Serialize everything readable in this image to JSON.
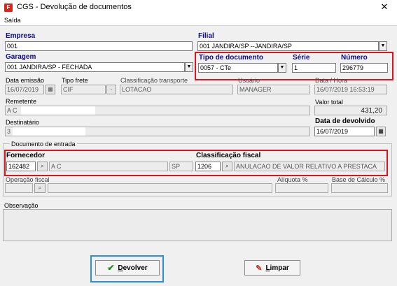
{
  "window": {
    "title": "CGS - Devolução de documentos",
    "close_glyph": "✕",
    "icon_letter": "F"
  },
  "menu": {
    "saida": "Saída"
  },
  "empresa": {
    "label": "Empresa",
    "value": "001"
  },
  "filial": {
    "label": "Filial",
    "value": "001 JANDIRA/SP --JANDIRA/SP"
  },
  "garagem": {
    "label": "Garagem",
    "value": "001 JANDIRA/SP - FECHADA"
  },
  "tipo_documento": {
    "label": "Tipo de documento",
    "value": "0057 - CTe"
  },
  "serie": {
    "label": "Série",
    "value": "1"
  },
  "numero": {
    "label": "Número",
    "value": "296779"
  },
  "data_emissao": {
    "label": "Data emissão",
    "value": "16/07/2019"
  },
  "tipo_frete": {
    "label": "Tipo frete",
    "value": "CIF"
  },
  "classificacao_transporte": {
    "label": "Classificação transporte",
    "value": "LOTACAO"
  },
  "usuario": {
    "label": "Usuário",
    "value": "MANAGER"
  },
  "data_hora": {
    "label": "Data / Hora",
    "value": "16/07/2019 16:53:19"
  },
  "remetente": {
    "label": "Remetente",
    "value": "A C"
  },
  "valor_total": {
    "label": "Valor total",
    "value": "431,20"
  },
  "destinatario": {
    "label": "Destinatário",
    "value": "3"
  },
  "data_devolvido": {
    "label": "Data de devolvido",
    "value": "16/07/2019"
  },
  "documento_entrada": {
    "label": "Documento de entrada"
  },
  "fornecedor": {
    "label": "Fornecedor",
    "code": "162482",
    "name": "A C",
    "uf": "SP"
  },
  "classificacao_fiscal": {
    "label": "Classificação fiscal",
    "code": "1206",
    "description": "ANULACAO DE VALOR RELATIVO A PRESTACA"
  },
  "operacao_fiscal": {
    "label": "Operação fiscal"
  },
  "aliquota": {
    "label": "Alíquota %"
  },
  "base_calculo": {
    "label": "Base de Cálculo %"
  },
  "observacao": {
    "label": "Observação"
  },
  "buttons": {
    "devolver": "Devolver",
    "devolver_rest": "evolver",
    "devolver_key": "D",
    "limpar": "Limpar",
    "limpar_rest": "impar",
    "limpar_key": "L"
  },
  "icons": {
    "search": "binoculars-icon",
    "calendar": "calendar-icon",
    "dropdown": "chevron-down-icon",
    "check": "check-icon",
    "eraser": "eraser-icon"
  }
}
